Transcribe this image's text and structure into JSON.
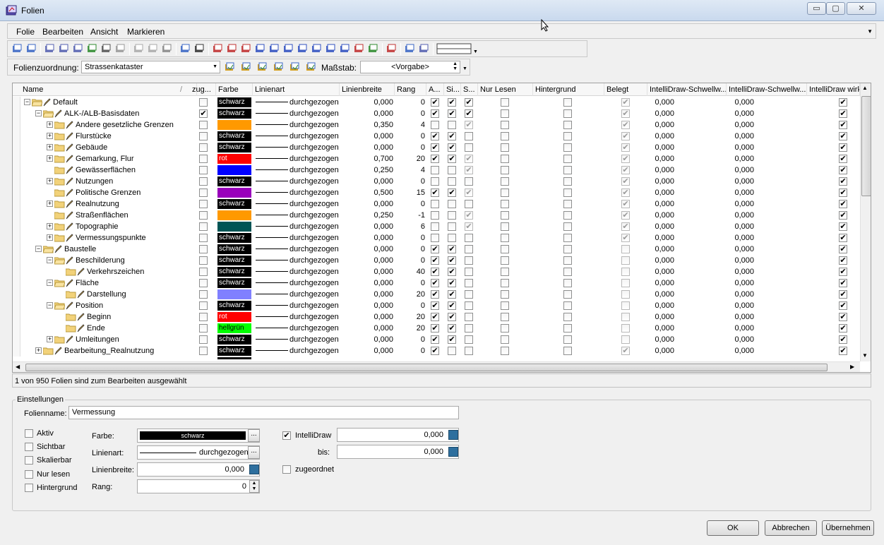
{
  "window": {
    "title": "Folien"
  },
  "menu": {
    "items": [
      "Folie",
      "Bearbeiten",
      "Ansicht",
      "Markieren"
    ]
  },
  "assign": {
    "label": "Folienzuordnung:",
    "value": "Strassenkataster",
    "scale_label": "Maßstab:",
    "scale_value": "<Vorgabe>"
  },
  "columns": [
    "Name",
    "zug...",
    "Farbe",
    "Linienart",
    "Linienbreite",
    "Rang",
    "A...",
    "Si...",
    "S...",
    "Nur Lesen",
    "Hintergrund",
    "Belegt",
    "IntelliDraw-Schwellw...",
    "IntelliDraw-Schwellw...",
    "IntelliDraw wirk"
  ],
  "rows": [
    {
      "name": "Default",
      "level": 0,
      "exp": "-",
      "open": true,
      "zug": false,
      "color": "schwarz",
      "hex": "#000000",
      "lw": "0,000",
      "rank": "0",
      "a": true,
      "si": true,
      "s": true,
      "s_dis": false,
      "belegt": true,
      "i1": "0,000",
      "i2": "0,000",
      "iw": true
    },
    {
      "name": "ALK-/ALB-Basisdaten",
      "level": 1,
      "exp": "-",
      "open": true,
      "zug": true,
      "color": "schwarz",
      "hex": "#000000",
      "lw": "0,000",
      "rank": "0",
      "a": true,
      "si": true,
      "s": true,
      "s_dis": false,
      "belegt": true,
      "i1": "0,000",
      "i2": "0,000",
      "iw": true
    },
    {
      "name": "Andere gesetzliche Grenzen",
      "level": 2,
      "exp": "+",
      "open": false,
      "zug": false,
      "color": "",
      "hex": "#ff9900",
      "lw": "0,350",
      "rank": "4",
      "a": false,
      "si": false,
      "s": true,
      "s_dis": true,
      "belegt": true,
      "i1": "0,000",
      "i2": "0,000",
      "iw": true
    },
    {
      "name": "Flurstücke",
      "level": 2,
      "exp": "+",
      "open": false,
      "zug": false,
      "color": "schwarz",
      "hex": "#000000",
      "lw": "0,000",
      "rank": "0",
      "a": true,
      "si": true,
      "s": false,
      "s_dis": false,
      "belegt": true,
      "i1": "0,000",
      "i2": "0,000",
      "iw": true
    },
    {
      "name": "Gebäude",
      "level": 2,
      "exp": "+",
      "open": false,
      "zug": false,
      "color": "schwarz",
      "hex": "#000000",
      "lw": "0,000",
      "rank": "0",
      "a": true,
      "si": true,
      "s": false,
      "s_dis": false,
      "belegt": true,
      "i1": "0,000",
      "i2": "0,000",
      "iw": true
    },
    {
      "name": "Gemarkung, Flur",
      "level": 2,
      "exp": "+",
      "open": false,
      "zug": false,
      "color": "rot",
      "hex": "#ff0000",
      "lw": "0,700",
      "rank": "20",
      "a": true,
      "si": true,
      "s": true,
      "s_dis": true,
      "belegt": true,
      "i1": "0,000",
      "i2": "0,000",
      "iw": true
    },
    {
      "name": "Gewässerflächen",
      "level": 2,
      "exp": "",
      "open": false,
      "zug": false,
      "color": "",
      "hex": "#0000ff",
      "lw": "0,250",
      "rank": "4",
      "a": false,
      "si": false,
      "s": true,
      "s_dis": true,
      "belegt": true,
      "i1": "0,000",
      "i2": "0,000",
      "iw": true
    },
    {
      "name": "Nutzungen",
      "level": 2,
      "exp": "+",
      "open": false,
      "zug": false,
      "color": "schwarz",
      "hex": "#000000",
      "lw": "0,000",
      "rank": "0",
      "a": false,
      "si": false,
      "s": false,
      "s_dis": false,
      "belegt": true,
      "i1": "0,000",
      "i2": "0,000",
      "iw": true
    },
    {
      "name": "Politische Grenzen",
      "level": 2,
      "exp": "",
      "open": false,
      "zug": false,
      "color": "",
      "hex": "#9900bb",
      "lw": "0,500",
      "rank": "15",
      "a": true,
      "si": true,
      "s": true,
      "s_dis": true,
      "belegt": true,
      "i1": "0,000",
      "i2": "0,000",
      "iw": true
    },
    {
      "name": "Realnutzung",
      "level": 2,
      "exp": "+",
      "open": false,
      "zug": false,
      "color": "schwarz",
      "hex": "#000000",
      "lw": "0,000",
      "rank": "0",
      "a": false,
      "si": false,
      "s": false,
      "s_dis": false,
      "belegt": true,
      "i1": "0,000",
      "i2": "0,000",
      "iw": true
    },
    {
      "name": "Straßenflächen",
      "level": 2,
      "exp": "",
      "open": false,
      "zug": false,
      "color": "",
      "hex": "#ff9900",
      "lw": "0,250",
      "rank": "-1",
      "a": false,
      "si": false,
      "s": true,
      "s_dis": true,
      "belegt": true,
      "i1": "0,000",
      "i2": "0,000",
      "iw": true
    },
    {
      "name": "Topographie",
      "level": 2,
      "exp": "+",
      "open": false,
      "zug": false,
      "color": "",
      "hex": "#005555",
      "lw": "0,000",
      "rank": "6",
      "a": false,
      "si": false,
      "s": true,
      "s_dis": true,
      "belegt": true,
      "i1": "0,000",
      "i2": "0,000",
      "iw": true
    },
    {
      "name": "Vermessungspunkte",
      "level": 2,
      "exp": "+",
      "open": false,
      "zug": false,
      "color": "schwarz",
      "hex": "#000000",
      "lw": "0,000",
      "rank": "0",
      "a": false,
      "si": false,
      "s": false,
      "s_dis": false,
      "belegt": true,
      "i1": "0,000",
      "i2": "0,000",
      "iw": true
    },
    {
      "name": "Baustelle",
      "level": 1,
      "exp": "-",
      "open": true,
      "zug": false,
      "color": "schwarz",
      "hex": "#000000",
      "lw": "0,000",
      "rank": "0",
      "a": true,
      "si": true,
      "s": false,
      "s_dis": false,
      "belegt": false,
      "i1": "0,000",
      "i2": "0,000",
      "iw": true
    },
    {
      "name": "Beschilderung",
      "level": 2,
      "exp": "-",
      "open": true,
      "zug": false,
      "color": "schwarz",
      "hex": "#000000",
      "lw": "0,000",
      "rank": "0",
      "a": true,
      "si": true,
      "s": false,
      "s_dis": false,
      "belegt": false,
      "i1": "0,000",
      "i2": "0,000",
      "iw": true
    },
    {
      "name": "Verkehrszeichen",
      "level": 3,
      "exp": "",
      "open": false,
      "zug": false,
      "color": "schwarz",
      "hex": "#000000",
      "lw": "0,000",
      "rank": "40",
      "a": true,
      "si": true,
      "s": false,
      "s_dis": false,
      "belegt": false,
      "i1": "0,000",
      "i2": "0,000",
      "iw": true
    },
    {
      "name": "Fläche",
      "level": 2,
      "exp": "-",
      "open": true,
      "zug": false,
      "color": "schwarz",
      "hex": "#000000",
      "lw": "0,000",
      "rank": "0",
      "a": true,
      "si": true,
      "s": false,
      "s_dis": false,
      "belegt": false,
      "i1": "0,000",
      "i2": "0,000",
      "iw": true
    },
    {
      "name": "Darstellung",
      "level": 3,
      "exp": "",
      "open": false,
      "zug": false,
      "color": "",
      "hex": "#8080ff",
      "lw": "0,000",
      "rank": "20",
      "a": true,
      "si": true,
      "s": false,
      "s_dis": false,
      "belegt": false,
      "i1": "0,000",
      "i2": "0,000",
      "iw": true
    },
    {
      "name": "Position",
      "level": 2,
      "exp": "-",
      "open": true,
      "zug": false,
      "color": "schwarz",
      "hex": "#000000",
      "lw": "0,000",
      "rank": "0",
      "a": true,
      "si": true,
      "s": false,
      "s_dis": false,
      "belegt": false,
      "i1": "0,000",
      "i2": "0,000",
      "iw": true
    },
    {
      "name": "Beginn",
      "level": 3,
      "exp": "",
      "open": false,
      "zug": false,
      "color": "rot",
      "hex": "#ff0000",
      "lw": "0,000",
      "rank": "20",
      "a": true,
      "si": true,
      "s": false,
      "s_dis": false,
      "belegt": false,
      "i1": "0,000",
      "i2": "0,000",
      "iw": true
    },
    {
      "name": "Ende",
      "level": 3,
      "exp": "",
      "open": false,
      "zug": false,
      "color": "hellgrün",
      "hex": "#00ff00",
      "lw": "0,000",
      "rank": "20",
      "a": true,
      "si": true,
      "s": false,
      "s_dis": false,
      "belegt": false,
      "i1": "0,000",
      "i2": "0,000",
      "iw": true
    },
    {
      "name": "Umleitungen",
      "level": 2,
      "exp": "+",
      "open": false,
      "zug": false,
      "color": "schwarz",
      "hex": "#000000",
      "lw": "0,000",
      "rank": "0",
      "a": true,
      "si": true,
      "s": false,
      "s_dis": false,
      "belegt": false,
      "i1": "0,000",
      "i2": "0,000",
      "iw": true
    },
    {
      "name": "Bearbeitung_Realnutzung",
      "level": 1,
      "exp": "+",
      "open": false,
      "zug": false,
      "color": "schwarz",
      "hex": "#000000",
      "lw": "0,000",
      "rank": "0",
      "a": true,
      "si": false,
      "s": false,
      "s_dis": false,
      "belegt": true,
      "i1": "0,000",
      "i2": "0,000",
      "iw": true
    }
  ],
  "linestyle_label": "durchgezogen",
  "status": "1 von 950 Folien sind zum Bearbeiten ausgewählt",
  "settings": {
    "group_title": "Einstellungen",
    "name_label": "Folienname:",
    "name_value": "Vermessung",
    "cb_aktiv": "Aktiv",
    "cb_sichtbar": "Sichtbar",
    "cb_skalierbar": "Skalierbar",
    "cb_nurlesen": "Nur lesen",
    "cb_hintergrund": "Hintergrund",
    "farbe_label": "Farbe:",
    "farbe_value": "schwarz",
    "linienart_label": "Linienart:",
    "linienart_value": "durchgezogen",
    "linienbreite_label": "Linienbreite:",
    "linienbreite_value": "0,000",
    "rang_label": "Rang:",
    "rang_value": "0",
    "intellidraw_label": "IntelliDraw",
    "intellidraw_value": "0,000",
    "bis_label": "bis:",
    "bis_value": "0,000",
    "zugeordnet_label": "zugeordnet"
  },
  "buttons": {
    "ok": "OK",
    "cancel": "Abbrechen",
    "apply": "Übernehmen"
  }
}
